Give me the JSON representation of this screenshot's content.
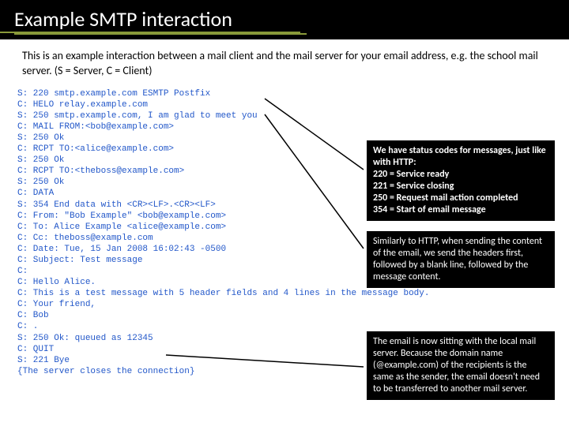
{
  "title": "Example SMTP interaction",
  "intro": "This is an example interaction between a mail client and the mail server for your email address, e.g. the school mail server. (S = Server, C = Client)",
  "smtp_lines": [
    "S: 220 smtp.example.com ESMTP Postfix",
    "C: HELO relay.example.com",
    "S: 250 smtp.example.com, I am glad to meet you",
    "C: MAIL FROM:<bob@example.com>",
    "S: 250 Ok",
    "C: RCPT TO:<alice@example.com>",
    "S: 250 Ok",
    "C: RCPT TO:<theboss@example.com>",
    "S: 250 Ok",
    "C: DATA",
    "S: 354 End data with <CR><LF>.<CR><LF>",
    "C: From: \"Bob Example\" <bob@example.com>",
    "C: To: Alice Example <alice@example.com>",
    "C: Cc: theboss@example.com",
    "C: Date: Tue, 15 Jan 2008 16:02:43 -0500",
    "C: Subject: Test message",
    "C:",
    "C: Hello Alice.",
    "C: This is a test message with 5 header fields and 4 lines in the message body.",
    "C: Your friend,",
    "C: Bob",
    "C: .",
    "S: 250 Ok: queued as 12345",
    "C: QUIT",
    "S: 221 Bye",
    "{The server closes the connection}"
  ],
  "callouts": {
    "status_codes": {
      "l1": "We have status codes for messages, just like with HTTP:",
      "l2": "220 = Service ready",
      "l3": "221 = Service closing",
      "l4": "250 = Request mail action completed",
      "l5": "354 = Start of email message"
    },
    "headers": "Similarly to HTTP, when sending the content of the email, we send the headers first, followed by a blank line, followed by the message content.",
    "queued": "The email is now sitting with the local mail server. Because the domain name (@example.com) of the recipients is the same as the sender, the email doesn't need to be transferred to another mail server."
  }
}
